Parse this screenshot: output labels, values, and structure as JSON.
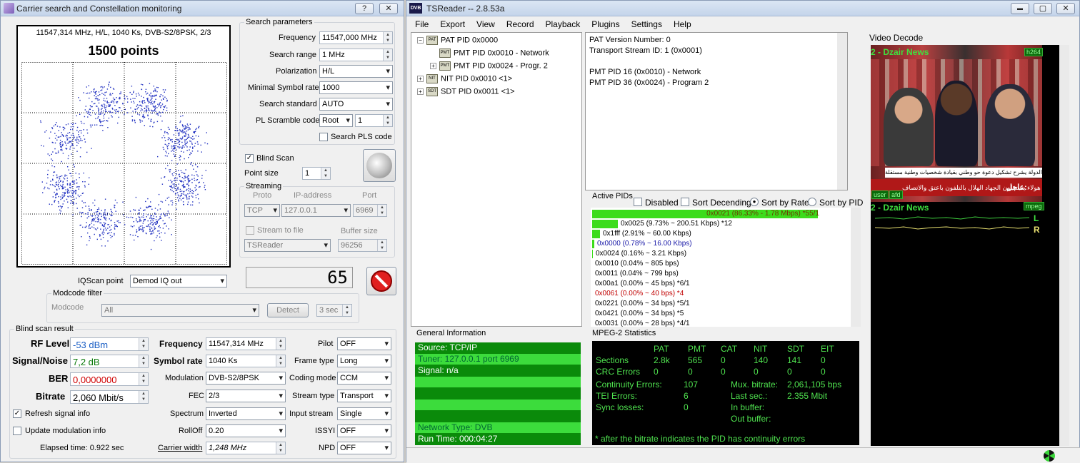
{
  "left_window": {
    "title": "Carrier search and Constellation monitoring",
    "help_btn": "?",
    "close_btn": "✕",
    "constellation": {
      "header": "11547,314 MHz, H/L, 1040 Ks, DVB-S2/8PSK, 2/3",
      "points_label": "1500 points",
      "point_color": "#1f2fc0"
    },
    "search_params": {
      "title": "Search parameters",
      "frequency_label": "Frequency",
      "frequency": "11547,000 MHz",
      "search_range_label": "Search range",
      "search_range": "1 MHz",
      "polarization_label": "Polarization",
      "polarization": "H/L",
      "min_sr_label": "Minimal Symbol rate",
      "min_sr": "1000",
      "standard_label": "Search standard",
      "standard": "AUTO",
      "pl_label": "PL Scramble code",
      "pl_mode": "Root",
      "pl_value": "1",
      "search_pls_label": "Search PLS code"
    },
    "blind_scan_label": "Blind Scan",
    "blind_scan_checked": "✓",
    "point_size_label": "Point size",
    "point_size": "1",
    "streaming": {
      "title": "Streaming",
      "proto_label": "Proto",
      "ip_label": "IP-address",
      "port_label": "Port",
      "proto": "TCP",
      "ip": "127.0.0.1",
      "port": "6969",
      "stream_file_label": "Stream to file",
      "buffer_label": "Buffer size",
      "file": "TSReader",
      "buffer": "96256"
    },
    "counter": "65",
    "iq_label": "IQScan point",
    "iq_value": "Demod IQ out",
    "modcode": {
      "title": "Modcode filter",
      "label": "Modcode",
      "value": "All",
      "detect_btn": "Detect",
      "interval": "3 sec"
    },
    "result": {
      "title": "Blind scan result",
      "rf_label": "RF Level",
      "rf": "-53 dBm",
      "sn_label": "Signal/Noise",
      "sn": "7,2 dB",
      "ber_label": "BER",
      "ber": "0,0000000",
      "bitrate_label": "Bitrate",
      "bitrate": "2,060 Mbit/s",
      "freq_label": "Frequency",
      "freq": "11547,314 MHz",
      "sr_label": "Symbol rate",
      "sr": "1040 Ks",
      "mod_label": "Modulation",
      "mod": "DVB-S2/8PSK",
      "fec_label": "FEC",
      "fec": "2/3",
      "spectrum_label": "Spectrum",
      "spectrum": "Inverted",
      "rolloff_label": "RollOff",
      "rolloff": "0.20",
      "cw_label": "Carrier width",
      "cw": "1,248 MHz",
      "pilot_label": "Pilot",
      "pilot": "OFF",
      "frame_label": "Frame type",
      "frame": "Long",
      "coding_label": "Coding mode",
      "coding": "CCM",
      "stype_label": "Stream type",
      "stype": "Transport",
      "istream_label": "Input stream",
      "istream": "Single",
      "issyi_label": "ISSYI",
      "issyi": "OFF",
      "npd_label": "NPD",
      "npd": "OFF"
    },
    "refresh_label": "Refresh signal info",
    "refresh_checked": "✓",
    "update_label": "Update modulation info",
    "elapsed": "Elapsed time: 0.922 sec"
  },
  "tsreader": {
    "title": "TSReader -- 2.8.53a",
    "app_icon": "DVB",
    "min_btn": "▬",
    "max_btn": "▢",
    "close_btn": "✕",
    "menu": [
      "File",
      "Export",
      "View",
      "Record",
      "Playback",
      "Plugins",
      "Settings",
      "Help"
    ],
    "tree": [
      {
        "icon": "PAT",
        "label": "PAT PID 0x0000",
        "expander": "−"
      },
      {
        "icon": "PMT",
        "label": "PMT PID 0x0010 - Network",
        "expander": ""
      },
      {
        "icon": "PMT",
        "label": "PMT PID 0x0024 - Progr. 2",
        "expander": "+"
      },
      {
        "icon": "NIT",
        "label": "NIT PID 0x0010 <1>",
        "expander": "+"
      },
      {
        "icon": "SDT",
        "label": "SDT PID 0x0011 <1>",
        "expander": "+"
      }
    ],
    "detail": [
      "PAT Version Number: 0",
      "Transport Stream ID: 1 (0x0001)",
      "",
      "PMT PID 16 (0x0010) - Network",
      "PMT PID 36 (0x0024) - Program 2"
    ],
    "active_pids": {
      "title": "Active PIDs",
      "disabled_label": "Disabled",
      "sort_desc_label": "Sort Decending",
      "sort_rate_label": "Sort by Rate",
      "sort_pid_label": "Sort by PID",
      "rows": [
        {
          "text": "0x0021 (86.33% - 1.78 Mbps) *55/1",
          "pct": 0.8633,
          "color": "#6b3a00"
        },
        {
          "text": "0x0025 (9.73% ~ 200.51 Kbps) *12",
          "pct": 0.0973,
          "color": "#000"
        },
        {
          "text": "0x1fff (2.91% ~ 60.00 Kbps)",
          "pct": 0.0291,
          "color": "#000"
        },
        {
          "text": "0x0000 (0.78% ~ 16.00 Kbps)",
          "pct": 0.0078,
          "color": "#1a1aa8"
        },
        {
          "text": "0x0024 (0.16% ~ 3.21 Kbps)",
          "pct": 0.0016,
          "color": "#000"
        },
        {
          "text": "0x0010 (0.04% ~ 805 bps)",
          "pct": 0,
          "color": "#000"
        },
        {
          "text": "0x0011 (0.04% ~ 799 bps)",
          "pct": 0,
          "color": "#000"
        },
        {
          "text": "0x00a1 (0.00% ~ 45 bps) *6/1",
          "pct": 0,
          "color": "#000"
        },
        {
          "text": "0x0061 (0.00% ~ 40 bps) *4",
          "pct": 0,
          "color": "#c00000"
        },
        {
          "text": "0x0221 (0.00% ~ 34 bps) *5/1",
          "pct": 0,
          "color": "#000"
        },
        {
          "text": "0x0421 (0.00% ~ 34 bps) *5",
          "pct": 0,
          "color": "#000"
        },
        {
          "text": "0x0031 (0.00% ~ 28 bps) *4/1",
          "pct": 0,
          "color": "#000"
        }
      ]
    },
    "general_info": {
      "title": "General Information",
      "lines": [
        "Source: TCP/IP",
        "Tuner: 127.0.0.1 port 6969",
        "Signal: n/a",
        "",
        "",
        "",
        "",
        "Network Type: DVB",
        "Run Time: 000:04:27"
      ]
    },
    "mpeg": {
      "title": "MPEG-2 Statistics",
      "headers": [
        "PAT",
        "PMT",
        "CAT",
        "NIT",
        "SDT",
        "EIT"
      ],
      "sections_label": "Sections",
      "sections": [
        "2.8k",
        "565",
        "0",
        "140",
        "141",
        "0"
      ],
      "crc_label": "CRC Errors",
      "crc": [
        "0",
        "0",
        "0",
        "0",
        "0",
        "0"
      ],
      "cont_label": "Continuity Errors:",
      "cont": "107",
      "tei_label": "TEI Errors:",
      "tei": "6",
      "sync_label": "Sync losses:",
      "sync": "0",
      "mux_label": "Mux. bitrate:",
      "mux": "2,061,105 bps",
      "last_label": "Last sec.:",
      "last": "2.355 Mbit",
      "inbuf_label": "In buffer:",
      "outbuf_label": "Out buffer:",
      "note": "* after the bitrate indicates the PID has continuity errors"
    },
    "video": {
      "title": "Video Decode",
      "channel": "2 - Dzair News",
      "badge_video": "h264",
      "badge_user": "user",
      "badge_afd": "afd",
      "channel2": "2 - Dzair News",
      "badge_audio": "mpeg",
      "ch_l": "L",
      "ch_r": "R",
      "ticker1": "بأيس الدولة يشرح تشكيل دعوة حو وطني بقيادة شخصيات وطنية مستقلة",
      "ticker2": "شرك صالح هولاء يستقلون الجهاد الهلال بالتلفون باعتق والاتصاف",
      "urgent": "عاجل:"
    }
  }
}
